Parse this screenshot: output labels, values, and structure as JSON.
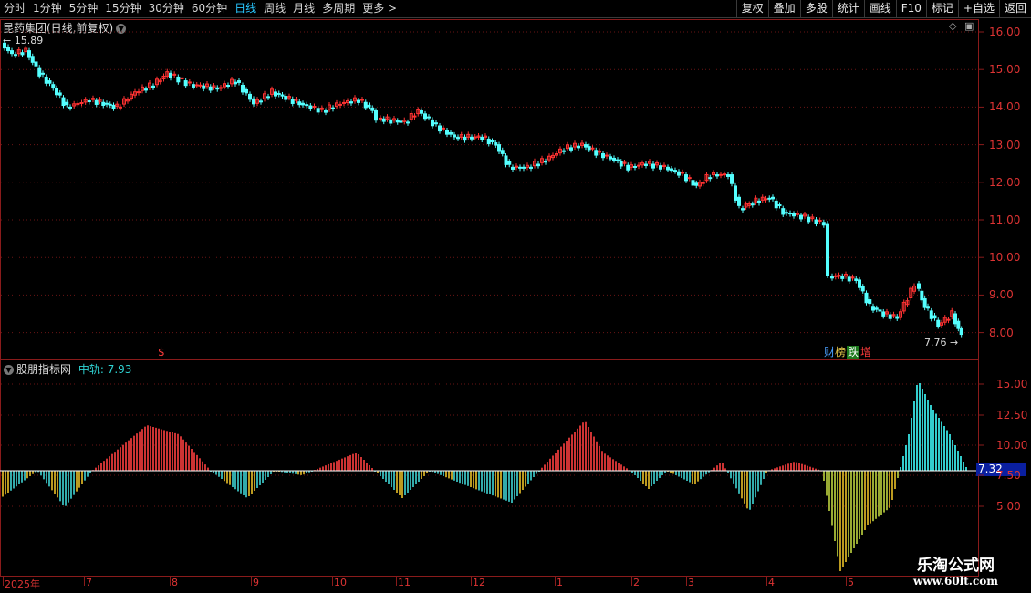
{
  "toolbar": {
    "periods": [
      "分时",
      "1分钟",
      "5分钟",
      "15分钟",
      "30分钟",
      "60分钟",
      "日线",
      "周线",
      "月线",
      "多周期",
      "更多 >"
    ],
    "active_period": "日线",
    "tools": [
      "复权",
      "叠加",
      "多股",
      "统计",
      "画线",
      "F10",
      "标记",
      "+自选",
      "返回"
    ]
  },
  "chart_header": {
    "title": "昆药集团(日线,前复权)",
    "high_label": "15.89",
    "low_label": "7.76"
  },
  "indicator_header": {
    "name": "股朋指标网",
    "mid_label": "中轨:",
    "mid_value": "7.93",
    "current_value": "7.32"
  },
  "price_axis": [
    "16.00",
    "15.00",
    "14.00",
    "13.00",
    "12.00",
    "11.00",
    "10.00",
    "9.00",
    "8.00"
  ],
  "indicator_axis": [
    "15.00",
    "12.50",
    "10.00",
    "7.50",
    "5.00"
  ],
  "date_axis": [
    "2025年",
    "7",
    "8",
    "9",
    "10",
    "11",
    "12",
    "1",
    "2",
    "3",
    "4",
    "5"
  ],
  "marker": "$",
  "badges": [
    "财",
    "榜",
    "跌",
    "增"
  ],
  "watermark": {
    "line1": "乐淘公式网",
    "line2": "www.60lt.com"
  },
  "colors": {
    "up": "#ff3232",
    "down": "#54ffff",
    "grid": "#8a1b1b",
    "active": "#29c7ff",
    "accent_blue": "#0a1fa0"
  }
}
